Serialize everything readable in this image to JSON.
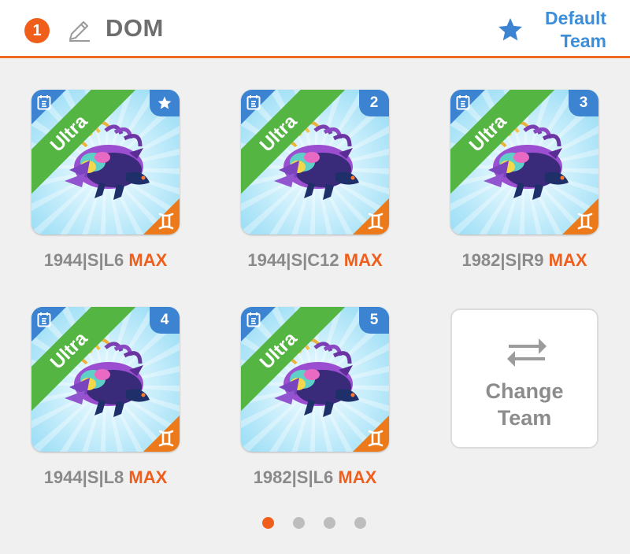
{
  "header": {
    "team_number": "1",
    "team_name": "DOM",
    "default_team_label_line1": "Default",
    "default_team_label_line2": "Team"
  },
  "cards": [
    {
      "rarity": "Ultra",
      "corner": "star-icon",
      "label_id": "1944|S|L6",
      "label_max": "MAX"
    },
    {
      "rarity": "Ultra",
      "corner": "2",
      "label_id": "1944|S|C12",
      "label_max": "MAX"
    },
    {
      "rarity": "Ultra",
      "corner": "3",
      "label_id": "1982|S|R9",
      "label_max": "MAX"
    },
    {
      "rarity": "Ultra",
      "corner": "4",
      "label_id": "1944|S|L8",
      "label_max": "MAX"
    },
    {
      "rarity": "Ultra",
      "corner": "5",
      "label_id": "1982|S|L6",
      "label_max": "MAX"
    }
  ],
  "change_team": {
    "line1": "Change",
    "line2": "Team"
  },
  "pagination": {
    "total": 4,
    "active": 1
  },
  "colors": {
    "accent": "#ef5f1b",
    "blue": "#3c84d2",
    "ribbon": "#55b543",
    "element": "#ec7a1a"
  }
}
